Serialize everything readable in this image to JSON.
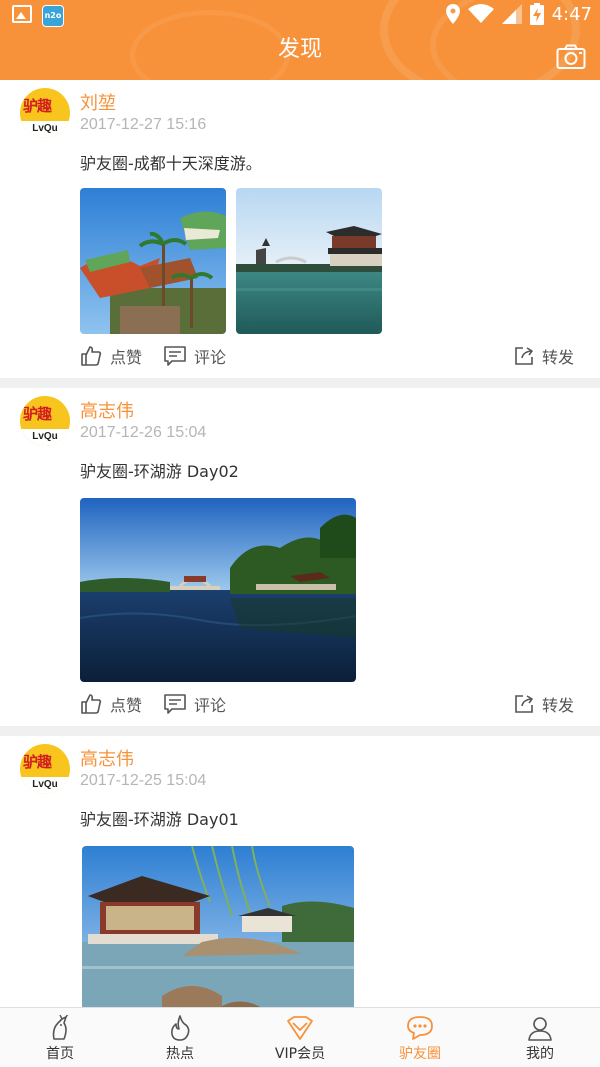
{
  "status_bar": {
    "time": "4:47",
    "app_icon_text": "n2o"
  },
  "header": {
    "title": "发现"
  },
  "posts": [
    {
      "name": "刘堃",
      "time": "2017-12-27 15:16",
      "text": "驴友圈-成都十天深度游。",
      "photo_count": 2,
      "photo_descriptions": [
        "dinosaur-park",
        "chinese-pavilion-lake"
      ],
      "like_label": "点赞",
      "comment_label": "评论",
      "share_label": "转发"
    },
    {
      "name": "高志伟",
      "time": "2017-12-26 15:04",
      "text": "驴友圈-环湖游 Day02",
      "photo_count": 1,
      "photo_descriptions": [
        "lake-bridge"
      ],
      "like_label": "点赞",
      "comment_label": "评论",
      "share_label": "转发"
    },
    {
      "name": "高志伟",
      "time": "2017-12-25 15:04",
      "text": "驴友圈-环湖游 Day01",
      "photo_count": 1,
      "photo_descriptions": [
        "pavilion-willow"
      ]
    }
  ],
  "avatar": {
    "logo_text": "驴趣",
    "logo_sub": "LvQu"
  },
  "bottom_nav": [
    {
      "label": "首页",
      "icon": "home-icon"
    },
    {
      "label": "热点",
      "icon": "flame-icon"
    },
    {
      "label": "VIP会员",
      "icon": "vip-icon"
    },
    {
      "label": "驴友圈",
      "icon": "chat-icon",
      "active": true
    },
    {
      "label": "我的",
      "icon": "user-icon"
    }
  ],
  "colors": {
    "accent": "#f7923a",
    "timestamp": "#b5b5b5"
  }
}
